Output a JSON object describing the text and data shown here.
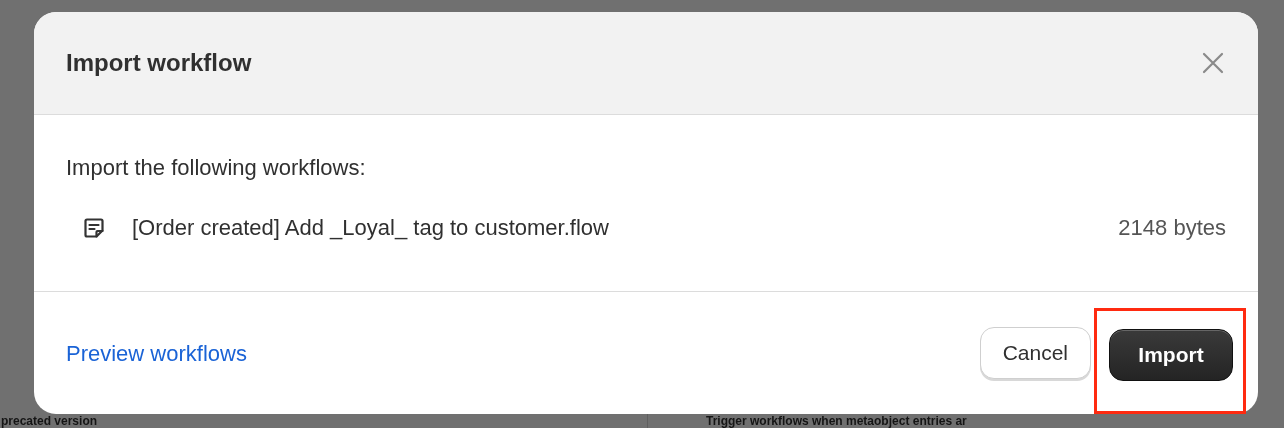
{
  "background_page": {
    "left_heading": "precated version",
    "right_heading": "Trigger workflows when metaobject entries ar"
  },
  "dialog": {
    "title": "Import workflow",
    "intro": "Import the following workflows:",
    "files": [
      {
        "name": "[Order created] Add _Loyal_ tag to customer.flow",
        "size": "2148 bytes"
      }
    ],
    "link": "Preview workflows",
    "buttons": [
      {
        "label": "Cancel",
        "kind": "secondary",
        "highlighted": false
      },
      {
        "label": "Import",
        "kind": "primary",
        "highlighted": true
      }
    ]
  }
}
